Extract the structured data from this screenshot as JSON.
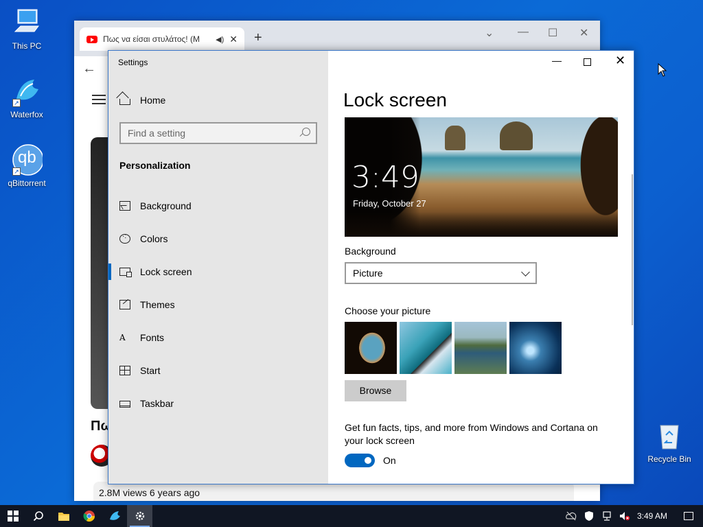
{
  "desktop": {
    "icons": [
      {
        "label": "This PC"
      },
      {
        "label": "Waterfox"
      },
      {
        "label": "qBittorrent",
        "glyph": "qb"
      },
      {
        "label": "Recycle Bin"
      }
    ]
  },
  "browser": {
    "tab_title": "Πως να είσαι στυλάτος! (Μ",
    "new_tab": "+",
    "video_title_partial": "Πω",
    "views_text": "2.8M views  6 years ago"
  },
  "settings": {
    "app_title": "Settings",
    "home_label": "Home",
    "search_placeholder": "Find a setting",
    "section": "Personalization",
    "nav": [
      {
        "label": "Background",
        "icon": "picture-icon"
      },
      {
        "label": "Colors",
        "icon": "palette-icon"
      },
      {
        "label": "Lock screen",
        "icon": "lock-screen-icon",
        "active": true
      },
      {
        "label": "Themes",
        "icon": "themes-icon"
      },
      {
        "label": "Fonts",
        "icon": "fonts-icon",
        "glyph": "A"
      },
      {
        "label": "Start",
        "icon": "start-icon"
      },
      {
        "label": "Taskbar",
        "icon": "taskbar-icon"
      }
    ],
    "page_title": "Lock screen",
    "preview": {
      "time": "3:49",
      "date": "Friday, October 27"
    },
    "background_label": "Background",
    "background_value": "Picture",
    "choose_label": "Choose your picture",
    "browse_label": "Browse",
    "facts_text": "Get fun facts, tips, and more from Windows and Cortana on your lock screen",
    "toggle_state": "On"
  },
  "taskbar": {
    "clock": "3:49 AM"
  },
  "colors": {
    "accent": "#0067c0",
    "taskbar": "#101623",
    "desktop": "#0b6ad6"
  }
}
